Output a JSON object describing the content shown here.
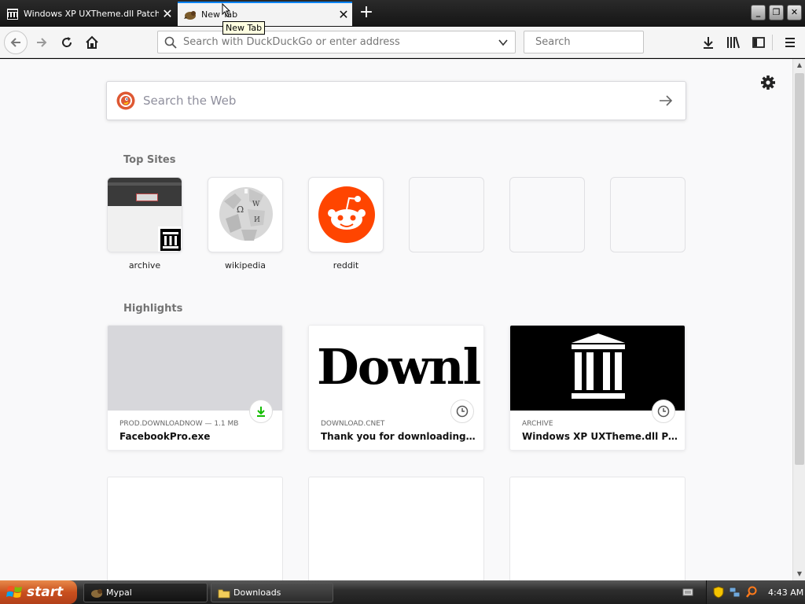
{
  "tabs": [
    {
      "title": "Windows XP UXTheme.dll Patches",
      "favicon": "archive-icon",
      "active": false
    },
    {
      "title": "New Tab",
      "favicon": "mypal-icon",
      "active": true
    }
  ],
  "tooltip": "New Tab",
  "toolbar": {
    "url_placeholder": "Search with DuckDuckGo or enter address",
    "search_placeholder": "Search"
  },
  "newtab": {
    "web_search_placeholder": "Search the Web",
    "top_sites_title": "Top Sites",
    "top_sites": [
      {
        "label": "archive",
        "thumb": "archive-screenshot"
      },
      {
        "label": "wikipedia",
        "thumb": "wikipedia-globe"
      },
      {
        "label": "reddit",
        "thumb": "reddit-alien"
      },
      {
        "label": "",
        "thumb": "empty"
      },
      {
        "label": "",
        "thumb": "empty"
      },
      {
        "label": "",
        "thumb": "empty"
      }
    ],
    "highlights_title": "Highlights",
    "highlights": [
      {
        "source": "PROD.DOWNLOADNOW — 1.1 MB",
        "title": "FacebookPro.exe",
        "badge": "download-icon"
      },
      {
        "source": "DOWNLOAD.CNET",
        "title": "Thank you for downloading Face...",
        "badge": "clock-icon",
        "thumb_text": "Downl"
      },
      {
        "source": "ARCHIVE",
        "title": "Windows XP UXTheme.dll Patch...",
        "badge": "clock-icon"
      }
    ]
  },
  "taskbar": {
    "start_label": "start",
    "tasks": [
      {
        "label": "Mypal",
        "icon": "mypal-icon"
      },
      {
        "label": "Downloads",
        "icon": "folder-icon"
      }
    ],
    "clock": "4:43 AM"
  },
  "colors": {
    "accent": "#0a84ff",
    "reddit": "#ff4500",
    "download_green": "#12bc00",
    "start_orange": "#c9501e"
  }
}
